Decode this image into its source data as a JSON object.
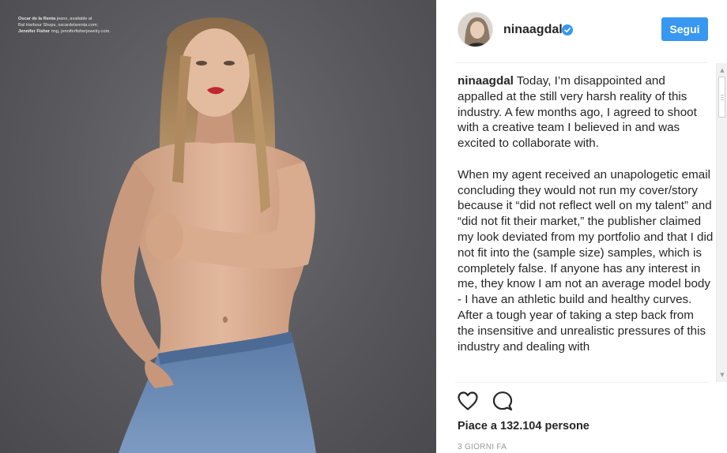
{
  "photo": {
    "credits_line1_bold": "Oscar de la Renta",
    "credits_line1_rest": " jeans, available at",
    "credits_line2": "Bal Harbour Shops, oscardelarenta.com;",
    "credits_line3_bold": "Jennifer Fisher",
    "credits_line3_rest": " ring, jenniferfisherjewelry.com."
  },
  "post": {
    "username": "ninaagdal",
    "follow_label": "Segui",
    "caption_user": "ninaagdal",
    "caption_p1": " Today, I’m disappointed and appalled at the still very harsh reality of this industry. A few months ago, I agreed to shoot with a creative team I believed in and was excited to collaborate with.",
    "caption_p2": "When my agent received an unapologetic email concluding they would not run my cover/story because it “did not reflect well on my talent” and “did not fit their market,” the publisher claimed my look deviated from my portfolio and that I did not fit into the (sample size) samples, which is completely false. If anyone has any interest in me, they know I am not an average model body - I have an athletic build and healthy curves.",
    "caption_p3": "After a tough year of taking a step back from the insensitive and unrealistic pressures of this industry and dealing with",
    "likes": "Piace a 132.104 persone",
    "timestamp": "3 GIORNI FA"
  },
  "icons": {
    "verified": "verified-badge-icon",
    "like": "heart-icon",
    "comment": "comment-bubble-icon",
    "scroll_up": "scroll-up-arrow-icon",
    "scroll_down": "scroll-down-arrow-icon"
  },
  "colors": {
    "accent": "#3897f0",
    "photo_background": "#5b5b5f",
    "text": "#262626",
    "muted": "#999999"
  }
}
